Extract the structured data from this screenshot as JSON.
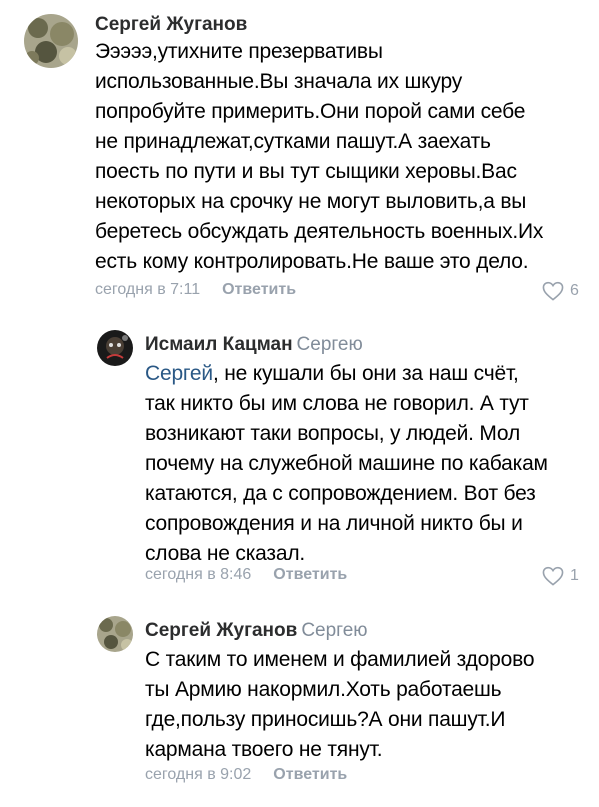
{
  "comments": [
    {
      "author": "Сергей Жуганов",
      "reply_to": "",
      "mention": "",
      "text": "Эээээ,утихните презервативы\nиспользованные.Вы значала их шкуру\nпопробуйте примерить.Они порой сами себе\nне принадлежат,сутками пашут.А заехать\nпоесть по пути и вы тут сыщики херовы.Вас\nнекоторых на срочку не могут выловить,а вы\nберетесь обсуждать деятельность военных.Их\nесть кому контролировать.Не ваше это дело.",
      "time": "сегодня в 7:11",
      "reply_label": "Ответить",
      "likes": "6",
      "avatar_icon": "user-avatar-camouflage"
    },
    {
      "author": "Исмаил Кацман",
      "reply_to": "Сергею",
      "mention": "Сергей",
      "text": ", не кушали бы они за наш счёт,\nтак никто бы им слова не говорил. А тут\nвозникают таки вопросы, у людей. Мол\nпочему на служебной машине по кабакам\nкатаются, да с сопровождением. Вот без\nсопровождения и на личной никто бы и\nслова не сказал.",
      "time": "сегодня в 8:46",
      "reply_label": "Ответить",
      "likes": "1",
      "avatar_icon": "user-avatar-dark"
    },
    {
      "author": "Сергей Жуганов",
      "reply_to": "Сергею",
      "mention": "",
      "text": "С таким то именем и фамилией здорово\nты Армию накормил.Хоть работаешь\nгде,пользу приносишь?А они пашут.И\nкармана твоего не тянут.",
      "time": "сегодня в 9:02",
      "reply_label": "Ответить",
      "likes": "",
      "avatar_icon": "user-avatar-camouflage"
    }
  ],
  "colors": {
    "author": "#2c2d2e",
    "meta": "#99a2ad",
    "mention": "#2a5885",
    "text": "#000000"
  }
}
